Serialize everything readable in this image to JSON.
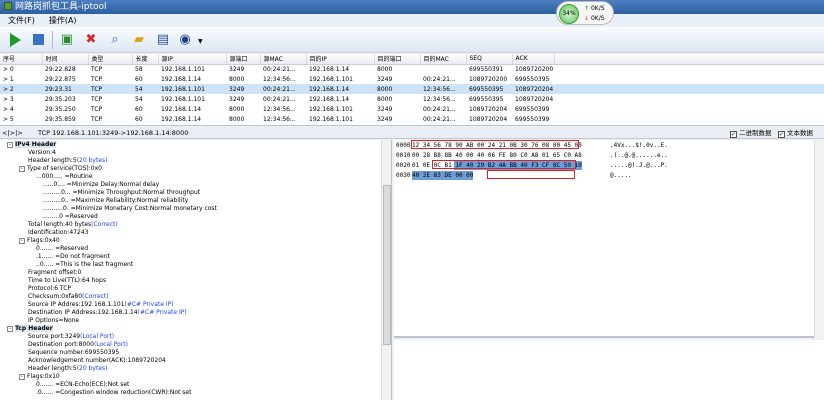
{
  "window": {
    "title": "网路岗抓包工具-iptool"
  },
  "menu": {
    "items": [
      "文件(F)",
      "操作(A)"
    ]
  },
  "net": {
    "percent": "34%",
    "up": "0K/S",
    "down": "0K/S"
  },
  "toolbar": {
    "buttons": [
      {
        "name": "start",
        "icon": "play-icon"
      },
      {
        "name": "stop",
        "icon": "stop-icon"
      },
      {
        "name": "capture-settings",
        "icon": "filter-icon"
      },
      {
        "name": "clear",
        "icon": "delete-icon"
      },
      {
        "name": "search",
        "icon": "search-icon"
      },
      {
        "name": "open",
        "icon": "folder-icon"
      },
      {
        "name": "save",
        "icon": "save-icon"
      },
      {
        "name": "more",
        "icon": "dropdown-icon"
      }
    ]
  },
  "packets": {
    "columns": [
      "序号",
      "时间",
      "类型",
      "长度",
      "源IP",
      "源端口",
      "源MAC",
      "目的IP",
      "目的端口",
      "目的MAC",
      "SEQ",
      "ACK"
    ],
    "rows": [
      [
        "0",
        "29:22.828",
        "TCP",
        "58",
        "192.168.1.101",
        "3249",
        "00:24:21...",
        "192.168.1.14",
        "8000",
        "",
        "699550391",
        "1089720200"
      ],
      [
        "1",
        "29:22.875",
        "TCP",
        "60",
        "192.168.1.14",
        "8000",
        "12:34:56...",
        "192.168.1.101",
        "3249",
        "00:24:21...",
        "1089720200",
        "699550395"
      ],
      [
        "2",
        "29:23.31",
        "TCP",
        "54",
        "192.168.1.101",
        "3249",
        "00:24:21...",
        "192.168.1.14",
        "8000",
        "12:34:56...",
        "699550395",
        "1089720204"
      ],
      [
        "3",
        "29:35.203",
        "TCP",
        "54",
        "192.168.1.101",
        "3249",
        "00:24:21...",
        "192.168.1.14",
        "8000",
        "12:34:56...",
        "699550395",
        "1089720204"
      ],
      [
        "4",
        "29:35.250",
        "TCP",
        "60",
        "192.168.1.14",
        "8000",
        "12:34:56...",
        "192.168.1.101",
        "3249",
        "00:24:21...",
        "1089720204",
        "699550399"
      ],
      [
        "5",
        "29:35.859",
        "TCP",
        "60",
        "192.168.1.14",
        "8000",
        "12:34:56...",
        "192.168.1.101",
        "3249",
        "00:24:21...",
        "1089720204",
        "699550399"
      ]
    ],
    "selected": 2
  },
  "status": {
    "nav": "<|>|>",
    "path": "TCP 192.168.1.101:3249->192.168.1.14:8000",
    "check1": "二进制数据",
    "check2": "文本数据"
  },
  "tree": [
    {
      "t": "IPv4 Header",
      "d": 0,
      "box": "-",
      "b": true
    },
    {
      "t": "Version:4",
      "d": 1
    },
    {
      "t": "Header length:5",
      "h": "(20 bytes)",
      "d": 1
    },
    {
      "t": "Type of service(TOS):0x0",
      "d": 1,
      "box": "-"
    },
    {
      "t": "...000..... =Routine",
      "d": 2
    },
    {
      "t": "......0.... =Minimize Delay:Normal delay",
      "d": 3
    },
    {
      "t": "..........0... =Minimize Throughput:Normal throughput",
      "d": 3
    },
    {
      "t": "..........0.. =Maximize Reliability:Normal reliability",
      "d": 3
    },
    {
      "t": "...........0. =Minimize Monetary Cost:Normal monetary cost",
      "d": 3
    },
    {
      "t": ".........0 =Reserved",
      "d": 3
    },
    {
      "t": "Total length:40 bytes",
      "h": "(Correct)",
      "d": 1
    },
    {
      "t": "Identification:47243",
      "d": 1
    },
    {
      "t": "Flags:0x40",
      "d": 1,
      "box": "-"
    },
    {
      "t": "0....... =Reserved",
      "d": 2
    },
    {
      "t": ".1...... =Do not fragment",
      "d": 2
    },
    {
      "t": "..0..... =This is the last fragment",
      "d": 2
    },
    {
      "t": "Fragment offset:0",
      "d": 1
    },
    {
      "t": "Time to Live(TTL):64 hops",
      "d": 1
    },
    {
      "t": "Protocol:6 TCP",
      "d": 1
    },
    {
      "t": "Checksum:0xfa80",
      "h": "(Correct)",
      "d": 1
    },
    {
      "t": "Source IP Addres:192.168.1.101",
      "h": "(#C# Private IP)",
      "d": 1
    },
    {
      "t": "Destination IP Address:192.168.1.14",
      "h": "(#C# Private IP)",
      "d": 1
    },
    {
      "t": "IP Options=None",
      "d": 1
    },
    {
      "t": "Tcp Header",
      "d": 0,
      "box": "-",
      "b": true
    },
    {
      "t": "Source port:3249",
      "h": "(Local Port)",
      "d": 1
    },
    {
      "t": "Destination port:8000",
      "h": "(Local Port)",
      "d": 1
    },
    {
      "t": "Sequence number:699550395",
      "d": 1
    },
    {
      "t": "Acknowledgement number(ACK):1089720204",
      "d": 1
    },
    {
      "t": "Header length:5",
      "h": "(20 bytes)",
      "d": 1
    },
    {
      "t": "Flags:0x10",
      "d": 1,
      "box": "-"
    },
    {
      "t": "0....... =ECN-Echo(ECE):Not set",
      "d": 2
    },
    {
      "t": ".0...... =Congestion window reduction(CWR):Not set",
      "d": 2
    }
  ],
  "hex": [
    {
      "off": "0000",
      "bytes": "12 34 56 78 90 AB 00 24 21 0B 30 76 08 00 45 00",
      "asc": ".4Vx...$!.0v..E."
    },
    {
      "off": "0010",
      "bytes": "00 28 B8 8B 40 00 40 06 FE 80 C0 A8 01 65 C0 A8",
      "asc": ".(..@.@......e.."
    },
    {
      "off": "0020",
      "bytes": "01 0E 0C B1 1F 40 29 B2 4A BB 40 F3 CF 8C 50 10",
      "asc": ".....@).J.@...P."
    },
    {
      "off": "0030",
      "bytes": "40 2E 83 DE 00 00",
      "asc": "@....."
    }
  ]
}
